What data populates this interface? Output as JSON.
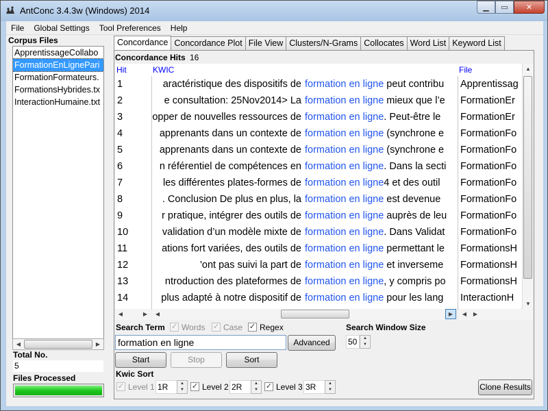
{
  "window": {
    "title": "AntConc 3.4.3w (Windows) 2014"
  },
  "menu": [
    "File",
    "Global Settings",
    "Tool Preferences",
    "Help"
  ],
  "corpus": {
    "title": "Corpus Files",
    "files": [
      "ApprentissageCollabo",
      "FormationEnLignePari",
      "FormationFormateurs.",
      "FormationsHybrides.tx",
      "InteractionHumaine.txt"
    ],
    "selected_index": 1,
    "total_label": "Total No.",
    "total_value": "5",
    "processed_label": "Files Processed",
    "processed_fraction": 1.0
  },
  "tabs": [
    "Concordance",
    "Concordance Plot",
    "File View",
    "Clusters/N-Grams",
    "Collocates",
    "Word List",
    "Keyword List"
  ],
  "active_tab": 0,
  "concordance": {
    "hits_label": "Concordance Hits",
    "hits_count": "16",
    "col_hit": "Hit",
    "col_kwic": "KWIC",
    "col_file": "File",
    "rows": [
      {
        "hit": "1",
        "left": "aractéristique des dispositifs de",
        "node": "formation en ligne",
        "right": " peut contribu",
        "file": "Apprentissag"
      },
      {
        "hit": "2",
        "left": "e consultation: 25Nov2014> La",
        "node": "formation en ligne",
        "right": " mieux que l’e",
        "file": "FormationEr"
      },
      {
        "hit": "3",
        "left": "opper de nouvelles ressources de",
        "node": "formation en ligne",
        "right": ". Peut-être le",
        "file": "FormationEr"
      },
      {
        "hit": "4",
        "left": "apprenants dans un contexte de",
        "node": "formation en ligne",
        "right": " (synchrone e",
        "file": "FormationFo"
      },
      {
        "hit": "5",
        "left": "apprenants dans un contexte de",
        "node": "formation en ligne",
        "right": " (synchrone e",
        "file": "FormationFo"
      },
      {
        "hit": "6",
        "left": "n référentiel de compétences en",
        "node": "formation en ligne",
        "right": ". Dans la secti",
        "file": "FormationFo"
      },
      {
        "hit": "7",
        "left": "les différentes plates-formes de",
        "node": "formation en ligne",
        "right": "4  et des outil",
        "file": "FormationFo"
      },
      {
        "hit": "8",
        "left": ". Conclusion De plus en plus, la",
        "node": "formation en ligne",
        "right": " est devenue",
        "file": "FormationFo"
      },
      {
        "hit": "9",
        "left": "r pratique, intégrer des outils de",
        "node": "formation en ligne",
        "right": " auprès de leu",
        "file": "FormationFo"
      },
      {
        "hit": "10",
        "left": "validation d’un modèle mixte de",
        "node": "formation en ligne",
        "right": ". Dans Validat",
        "file": "FormationFo"
      },
      {
        "hit": "11",
        "left": "ations fort variées, des outils de",
        "node": "formation en ligne",
        "right": " permettant le",
        "file": "FormationsH"
      },
      {
        "hit": "12",
        "left": "'ont pas suivi la part de",
        "node": "formation en ligne",
        "right": " et inverseme",
        "file": "FormationsH"
      },
      {
        "hit": "13",
        "left": "ntroduction des plateformes de",
        "node": "formation en ligne",
        "right": ", y compris po",
        "file": "FormationsH"
      },
      {
        "hit": "14",
        "left": "plus adapté à notre dispositif de",
        "node": "formation en ligne",
        "right": " pour les lang",
        "file": "InteractionH"
      }
    ]
  },
  "search": {
    "term_label": "Search Term",
    "words_label": "Words",
    "case_label": "Case",
    "regex_label": "Regex",
    "term_value": "formation en ligne",
    "advanced_label": "Advanced",
    "window_label": "Search Window Size",
    "window_value": "50",
    "start_label": "Start",
    "stop_label": "Stop",
    "sort_label": "Sort"
  },
  "kwic_sort": {
    "label": "Kwic Sort",
    "level1_label": "Level 1",
    "level1_value": "1R",
    "level2_label": "Level 2",
    "level2_value": "2R",
    "level3_label": "Level 3",
    "level3_value": "3R",
    "clone_label": "Clone Results"
  },
  "colors": {
    "node": "#2255ee",
    "selection": "#3399ff",
    "progress": "#1ec81e",
    "column_header": "#0000ff"
  }
}
